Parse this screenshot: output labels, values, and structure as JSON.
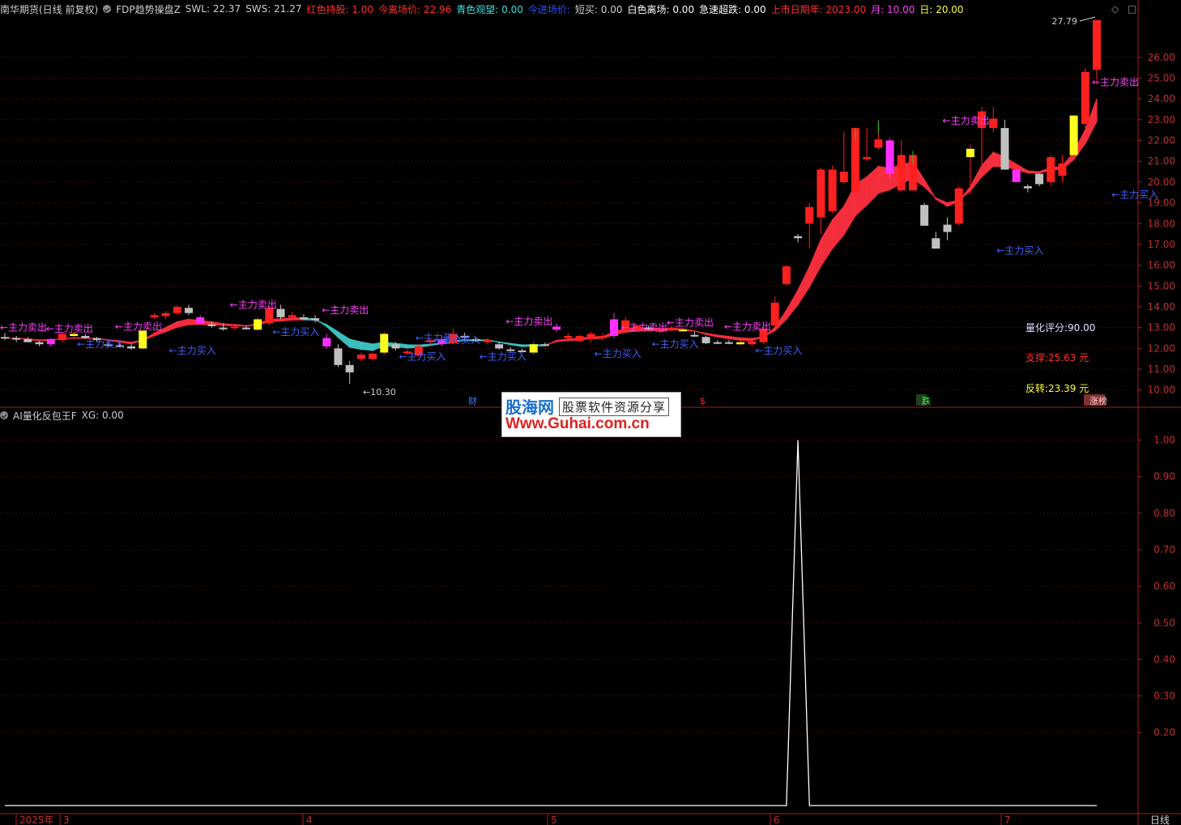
{
  "header": {
    "items": [
      {
        "text": "南华期货(日线 前复权)",
        "color": "#d0d0d0"
      },
      {
        "text": "FDP趋势操盘Z",
        "color": "#d0d0d0",
        "icon": true
      },
      {
        "text": "SWL: 22.37",
        "color": "#d0d0d0"
      },
      {
        "text": "SWS: 21.27",
        "color": "#d0d0d0"
      },
      {
        "text": "红色持股: 1.00",
        "color": "#ff3030"
      },
      {
        "text": "今离场价: 22.96",
        "color": "#ff3030"
      },
      {
        "text": "青色观望: 0.00",
        "color": "#40e0e0"
      },
      {
        "text": "今进场价: ",
        "color": "#3050ff"
      },
      {
        "text": "短买: 0.00",
        "color": "#d0d0d0"
      },
      {
        "text": "白色离场: 0.00",
        "color": "#ffffff"
      },
      {
        "text": "急速超跌: 0.00",
        "color": "#ffffff"
      },
      {
        "text": "上市日期年: 2023.00",
        "color": "#ff3030"
      },
      {
        "text": "月: 10.00",
        "color": "#ff40ff"
      },
      {
        "text": "日: 20.00",
        "color": "#ffff40"
      }
    ]
  },
  "sub_header": {
    "name": "AI量化反包王F",
    "value": "XG: 0.00"
  },
  "right_panel_buttons": {
    "diamond": "◇",
    "square": "□"
  },
  "price_axis": [
    "26.00",
    "25.00",
    "24.00",
    "23.00",
    "22.00",
    "21.00",
    "20.00",
    "19.00",
    "18.00",
    "17.00",
    "16.00",
    "15.00",
    "14.00",
    "13.00",
    "12.00",
    "11.00",
    "10.00"
  ],
  "indicator_axis": [
    "1.00",
    "0.90",
    "0.80",
    "0.70",
    "0.60",
    "0.50",
    "0.40",
    "0.30",
    "0.20"
  ],
  "date_axis": [
    {
      "label": "2025年"
    },
    {
      "label": "3"
    },
    {
      "label": "4"
    },
    {
      "label": "5"
    },
    {
      "label": "6"
    },
    {
      "label": "7"
    }
  ],
  "period_label": "日线",
  "max_label": "27.79",
  "min_label": "←10.30",
  "info_texts": {
    "score": "量化评分:90.00",
    "support": "支撑:25.63 元",
    "reverse": "反转:23.39 元"
  },
  "event_tags": [
    "财",
    "$",
    "跌",
    "涨榜"
  ],
  "signals": {
    "sell": "←主力卖出",
    "buy": "←主力买入"
  },
  "watermark": {
    "brand": "股海网",
    "slogan": "股票软件资源分享",
    "url": "Www.Guhai.com.cn"
  },
  "colors": {
    "up": "#ff2020",
    "down_gray": "#c0c0c0",
    "magenta": "#ff30ff",
    "yellow": "#ffff20",
    "cyan_band": "#40c8c8",
    "red_band": "#ff3040",
    "grid": "#6a1010",
    "axis_text": "#c03030",
    "buy_text": "#4060ff",
    "sell_text": "#ff40ff"
  },
  "chart_data": [
    {
      "type": "candlestick",
      "title": "南华期货(日线 前复权)",
      "ylim": [
        9.6,
        27.9
      ],
      "series": [
        {
          "name": "K线",
          "ohlc": [
            [
              12.55,
              12.75,
              12.4,
              12.5
            ],
            [
              12.5,
              12.6,
              12.3,
              12.45
            ],
            [
              12.45,
              12.55,
              12.3,
              12.3
            ],
            [
              12.3,
              12.35,
              12.1,
              12.2
            ],
            [
              12.2,
              12.5,
              12.1,
              12.45
            ],
            [
              12.4,
              12.75,
              12.3,
              12.7
            ],
            [
              12.7,
              12.8,
              12.55,
              12.6
            ],
            [
              12.6,
              12.7,
              12.45,
              12.5
            ],
            [
              12.5,
              12.55,
              12.3,
              12.4
            ],
            [
              12.2,
              12.35,
              12.05,
              12.15
            ],
            [
              12.15,
              12.25,
              12.05,
              12.1
            ],
            [
              12.1,
              12.2,
              11.95,
              12.0
            ],
            [
              12.0,
              12.9,
              11.95,
              12.85
            ],
            [
              13.5,
              13.7,
              13.4,
              13.6
            ],
            [
              13.55,
              13.8,
              13.4,
              13.7
            ],
            [
              13.7,
              14.1,
              13.6,
              14.0
            ],
            [
              13.95,
              14.1,
              13.6,
              13.7
            ],
            [
              13.5,
              13.6,
              13.2,
              13.2
            ],
            [
              13.15,
              13.3,
              13.0,
              13.1
            ],
            [
              13.0,
              13.2,
              12.85,
              12.95
            ],
            [
              13.0,
              13.2,
              12.9,
              13.05
            ],
            [
              13.0,
              13.1,
              12.9,
              12.95
            ],
            [
              12.9,
              13.5,
              12.85,
              13.4
            ],
            [
              13.2,
              14.0,
              13.1,
              13.95
            ],
            [
              13.9,
              14.1,
              13.4,
              13.5
            ],
            [
              13.5,
              13.75,
              13.35,
              13.6
            ],
            [
              13.5,
              13.65,
              13.35,
              13.4
            ],
            [
              13.45,
              13.6,
              13.25,
              13.35
            ],
            [
              12.5,
              12.7,
              12.0,
              12.1
            ],
            [
              12.0,
              12.2,
              11.1,
              11.2
            ],
            [
              11.2,
              11.4,
              10.3,
              10.85
            ],
            [
              11.5,
              11.8,
              11.4,
              11.7
            ],
            [
              11.5,
              11.8,
              11.4,
              11.75
            ],
            [
              11.8,
              12.8,
              11.7,
              12.7
            ],
            [
              12.2,
              12.3,
              11.9,
              12.0
            ],
            [
              11.8,
              11.95,
              11.7,
              11.85
            ],
            [
              11.65,
              12.2,
              11.6,
              12.1
            ],
            [
              12.3,
              12.5,
              12.15,
              12.4
            ],
            [
              12.2,
              12.55,
              12.1,
              12.45
            ],
            [
              12.25,
              12.95,
              12.2,
              12.7
            ],
            [
              12.6,
              12.75,
              12.45,
              12.55
            ],
            [
              12.45,
              12.55,
              12.3,
              12.4
            ],
            [
              12.3,
              12.5,
              12.2,
              12.4
            ],
            [
              12.2,
              12.3,
              11.95,
              12.0
            ],
            [
              11.95,
              12.05,
              11.85,
              11.9
            ],
            [
              11.9,
              12.0,
              11.8,
              11.85
            ],
            [
              11.8,
              12.3,
              11.7,
              12.2
            ],
            [
              12.2,
              12.3,
              12.1,
              12.15
            ],
            [
              12.9,
              13.2,
              12.8,
              13.05
            ],
            [
              12.5,
              12.75,
              12.45,
              12.6
            ],
            [
              12.35,
              12.65,
              12.3,
              12.6
            ],
            [
              12.45,
              12.8,
              12.3,
              12.7
            ],
            [
              12.5,
              12.75,
              12.4,
              12.6
            ],
            [
              12.6,
              13.7,
              12.5,
              13.4
            ],
            [
              12.9,
              13.5,
              12.85,
              13.35
            ],
            [
              12.9,
              13.1,
              12.8,
              13.1
            ],
            [
              13.0,
              13.1,
              12.85,
              12.95
            ],
            [
              12.8,
              13.0,
              12.7,
              12.9
            ],
            [
              12.9,
              13.1,
              12.8,
              13.0
            ],
            [
              12.9,
              13.0,
              12.8,
              12.85
            ],
            [
              12.65,
              12.8,
              12.55,
              12.6
            ],
            [
              12.55,
              12.6,
              12.2,
              12.25
            ],
            [
              12.3,
              12.4,
              12.2,
              12.25
            ],
            [
              12.3,
              12.4,
              12.2,
              12.25
            ],
            [
              12.3,
              12.35,
              12.15,
              12.2
            ],
            [
              12.2,
              12.4,
              12.1,
              12.35
            ],
            [
              12.3,
              13.3,
              12.2,
              12.95
            ],
            [
              13.1,
              14.5,
              13.0,
              14.2
            ],
            [
              15.1,
              16.0,
              15.0,
              15.95
            ],
            [
              17.4,
              17.5,
              17.1,
              17.3
            ],
            [
              18.0,
              19.0,
              16.8,
              18.8
            ],
            [
              18.3,
              20.7,
              17.5,
              20.6
            ],
            [
              18.6,
              20.8,
              18.5,
              20.6
            ],
            [
              20.0,
              22.4,
              19.9,
              20.5
            ],
            [
              19.5,
              22.6,
              19.5,
              22.6
            ],
            [
              21.1,
              22.6,
              21.0,
              21.2
            ],
            [
              21.65,
              22.95,
              21.55,
              22.05
            ],
            [
              22.0,
              22.1,
              20.2,
              20.4
            ],
            [
              19.6,
              22.0,
              19.5,
              21.3
            ],
            [
              19.6,
              21.5,
              19.6,
              21.3
            ],
            [
              18.9,
              19.0,
              17.9,
              17.9
            ],
            [
              17.3,
              17.6,
              16.8,
              16.8
            ],
            [
              17.6,
              18.3,
              17.2,
              17.95
            ],
            [
              18.0,
              19.8,
              17.9,
              19.7
            ],
            [
              21.2,
              21.8,
              19.4,
              21.6
            ],
            [
              22.6,
              23.6,
              20.5,
              23.4
            ],
            [
              22.6,
              23.6,
              22.4,
              23.05
            ],
            [
              22.6,
              23.0,
              20.6,
              20.6
            ],
            [
              20.6,
              20.6,
              20.0,
              20.0
            ],
            [
              19.8,
              19.9,
              19.5,
              19.7
            ],
            [
              19.9,
              20.4,
              19.8,
              20.4
            ],
            [
              20.0,
              21.3,
              19.8,
              21.2
            ],
            [
              20.3,
              21.3,
              20.0,
              20.9
            ],
            [
              21.3,
              23.2,
              21.1,
              23.2
            ],
            [
              22.8,
              25.5,
              22.6,
              25.3
            ],
            [
              25.4,
              27.79,
              24.7,
              27.79
            ]
          ]
        }
      ]
    },
    {
      "type": "line",
      "title": "AI量化反包王F",
      "ylim": [
        0,
        1.05
      ],
      "series": [
        {
          "name": "XG",
          "values": [
            0,
            0,
            0,
            0,
            0,
            0,
            0,
            0,
            0,
            0,
            0,
            0,
            0,
            0,
            0,
            0,
            0,
            0,
            0,
            0,
            0,
            0,
            0,
            0,
            0,
            0,
            0,
            0,
            0,
            0,
            0,
            0,
            0,
            0,
            0,
            0,
            0,
            0,
            0,
            0,
            0,
            0,
            0,
            0,
            0,
            0,
            0,
            0,
            0,
            0,
            0,
            0,
            0,
            0,
            0,
            0,
            0,
            0,
            0,
            0,
            0,
            0,
            0,
            0,
            0,
            0,
            0,
            0,
            0,
            1,
            0,
            0,
            0,
            0,
            0,
            0,
            0,
            0,
            0,
            0,
            0,
            0,
            0,
            0,
            0,
            0,
            0,
            0,
            0,
            0,
            0,
            0,
            0,
            0,
            0,
            0
          ]
        }
      ]
    }
  ]
}
